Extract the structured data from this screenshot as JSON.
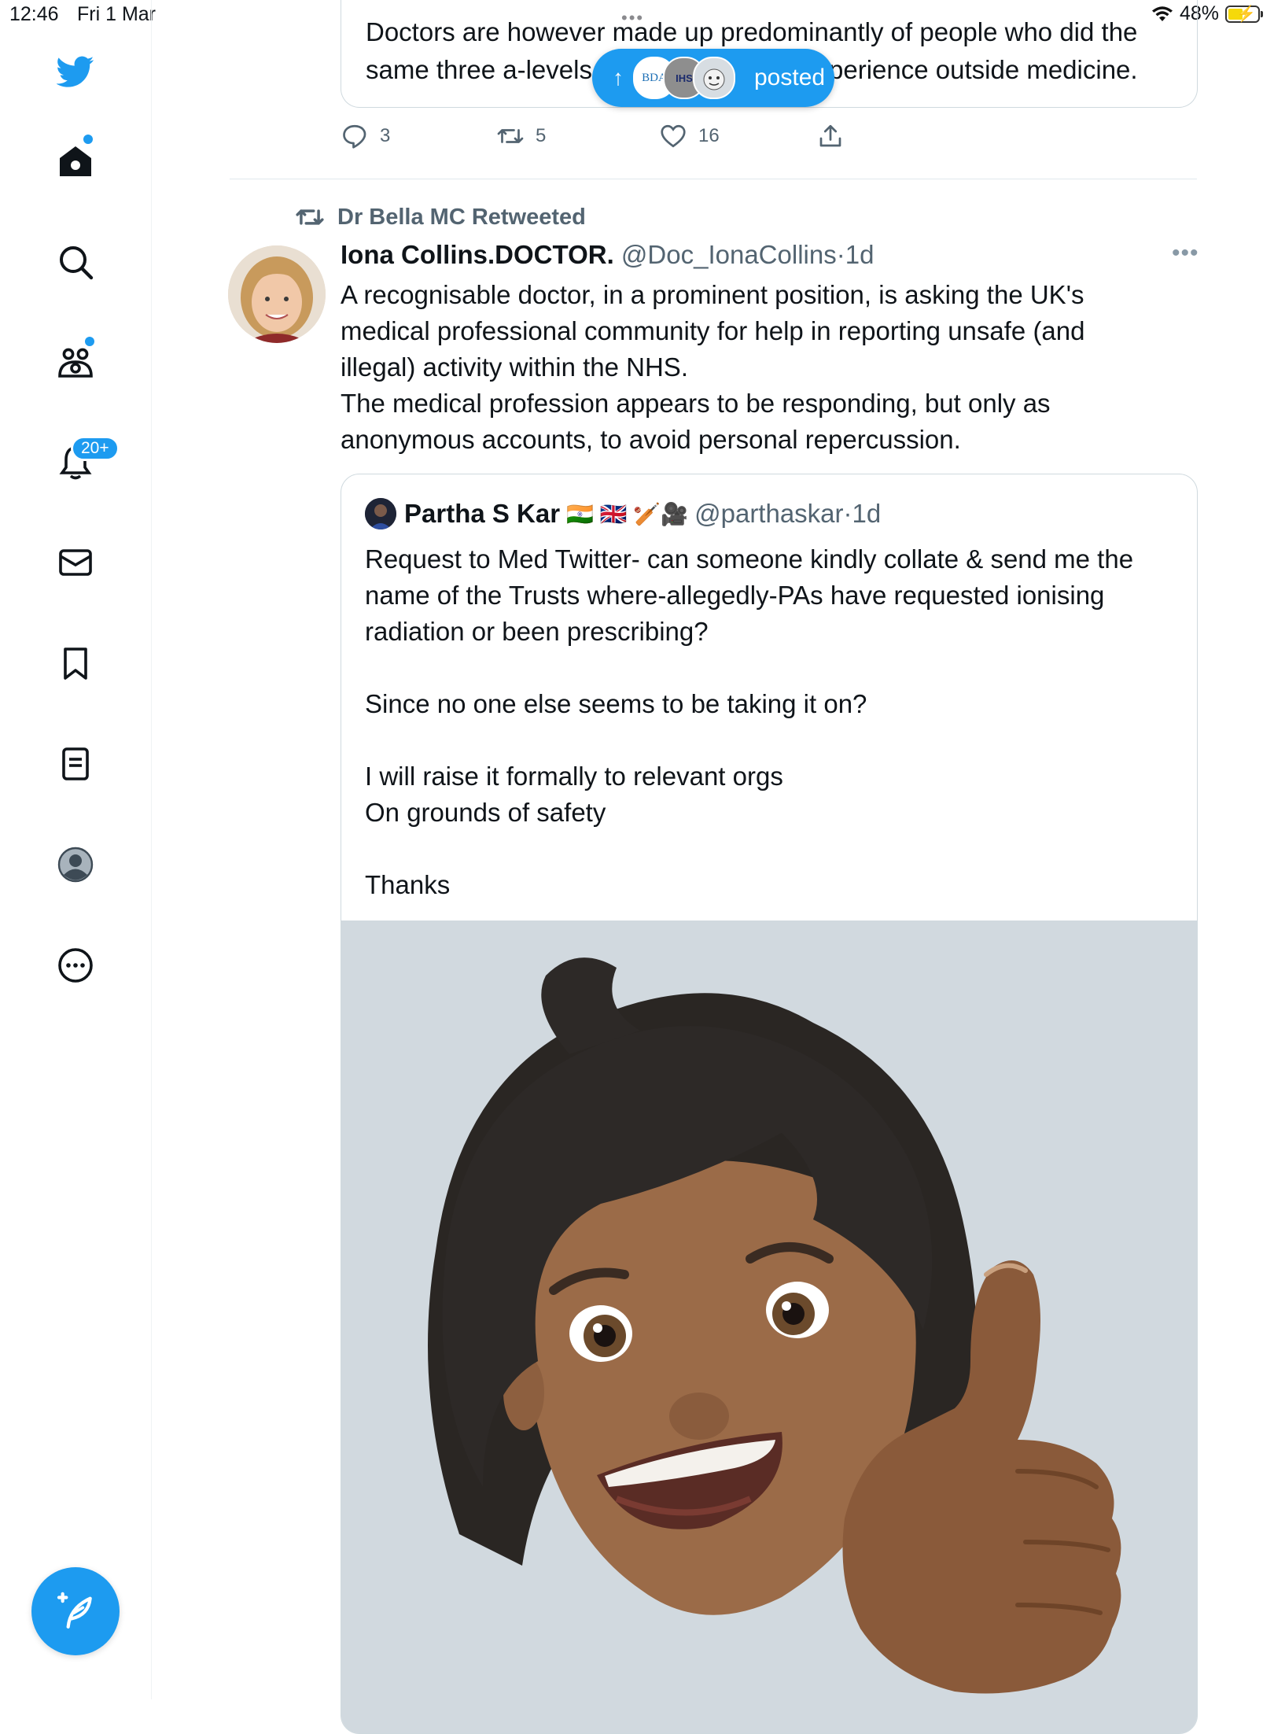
{
  "status_bar": {
    "time": "12:46",
    "date": "Fri 1 Mar",
    "more": "•••",
    "battery": "48%"
  },
  "sidebar": {
    "items": [
      {
        "name": "home",
        "icon": "home-icon"
      },
      {
        "name": "explore",
        "icon": "search-icon"
      },
      {
        "name": "communities",
        "icon": "communities-icon"
      },
      {
        "name": "notifications",
        "icon": "bell-icon",
        "badge": "20+"
      },
      {
        "name": "messages",
        "icon": "mail-icon"
      },
      {
        "name": "bookmarks",
        "icon": "bookmark-icon"
      },
      {
        "name": "lists",
        "icon": "lists-icon"
      },
      {
        "name": "profile",
        "icon": "profile-icon"
      },
      {
        "name": "more",
        "icon": "more-circle-icon"
      }
    ],
    "notification_badge": "20+",
    "accent": "#1d9bf0"
  },
  "previous_tweet": {
    "line1": "Doctors are however made up predominantly of people who did the",
    "line2_start": "same three a-levels",
    "line2_end": "perience outside medicine.",
    "replies": "3",
    "retweets": "5",
    "likes": "16"
  },
  "new_posts_pill": {
    "arrow": "↑",
    "label": "posted",
    "avatar_texts": [
      "BDA",
      "IHS"
    ]
  },
  "tweet": {
    "retweeted_by": "Dr Bella MC Retweeted",
    "author_name": "Iona Collins.DOCTOR.",
    "author_handle": "@Doc_IonaCollins",
    "separator": "·",
    "time": "1d",
    "more": "•••",
    "body_lines": [
      "A recognisable doctor, in a prominent position, is asking the UK's",
      "medical professional community for help in reporting unsafe (and",
      "illegal) activity within the NHS.",
      "The medical profession appears to be responding, but only as",
      "anonymous accounts, to avoid personal repercussion."
    ]
  },
  "quoted_tweet": {
    "author_name": "Partha S Kar",
    "author_emojis": "🇮🇳 🇬🇧 🏏🎥",
    "author_handle": "@parthaskar",
    "separator": "·",
    "time": "1d",
    "body_lines": [
      "Request to Med Twitter- can someone kindly collate &  send me the",
      "name of the Trusts where-allegedly-PAs have requested ionising",
      "radiation or been prescribing?",
      "",
      "Since no one else seems to be taking it on?",
      "",
      "I will raise it formally to relevant orgs",
      "On grounds of safety",
      "",
      "Thanks"
    ],
    "image_description_icon": "memoji-thumbs-up"
  }
}
